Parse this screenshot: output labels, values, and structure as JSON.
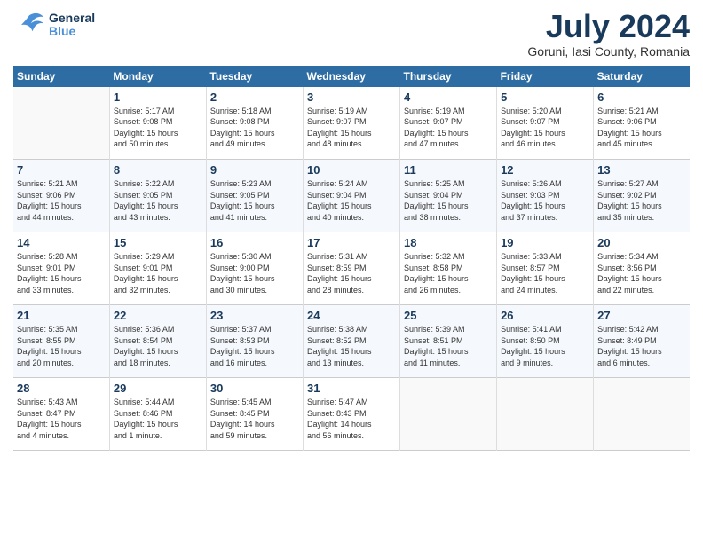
{
  "header": {
    "logo_general": "General",
    "logo_blue": "Blue",
    "month_title": "July 2024",
    "location": "Goruni, Iasi County, Romania"
  },
  "calendar": {
    "days_of_week": [
      "Sunday",
      "Monday",
      "Tuesday",
      "Wednesday",
      "Thursday",
      "Friday",
      "Saturday"
    ],
    "weeks": [
      {
        "cells": [
          {
            "day": "",
            "info": ""
          },
          {
            "day": "1",
            "info": "Sunrise: 5:17 AM\nSunset: 9:08 PM\nDaylight: 15 hours\nand 50 minutes."
          },
          {
            "day": "2",
            "info": "Sunrise: 5:18 AM\nSunset: 9:08 PM\nDaylight: 15 hours\nand 49 minutes."
          },
          {
            "day": "3",
            "info": "Sunrise: 5:19 AM\nSunset: 9:07 PM\nDaylight: 15 hours\nand 48 minutes."
          },
          {
            "day": "4",
            "info": "Sunrise: 5:19 AM\nSunset: 9:07 PM\nDaylight: 15 hours\nand 47 minutes."
          },
          {
            "day": "5",
            "info": "Sunrise: 5:20 AM\nSunset: 9:07 PM\nDaylight: 15 hours\nand 46 minutes."
          },
          {
            "day": "6",
            "info": "Sunrise: 5:21 AM\nSunset: 9:06 PM\nDaylight: 15 hours\nand 45 minutes."
          }
        ]
      },
      {
        "cells": [
          {
            "day": "7",
            "info": "Sunrise: 5:21 AM\nSunset: 9:06 PM\nDaylight: 15 hours\nand 44 minutes."
          },
          {
            "day": "8",
            "info": "Sunrise: 5:22 AM\nSunset: 9:05 PM\nDaylight: 15 hours\nand 43 minutes."
          },
          {
            "day": "9",
            "info": "Sunrise: 5:23 AM\nSunset: 9:05 PM\nDaylight: 15 hours\nand 41 minutes."
          },
          {
            "day": "10",
            "info": "Sunrise: 5:24 AM\nSunset: 9:04 PM\nDaylight: 15 hours\nand 40 minutes."
          },
          {
            "day": "11",
            "info": "Sunrise: 5:25 AM\nSunset: 9:04 PM\nDaylight: 15 hours\nand 38 minutes."
          },
          {
            "day": "12",
            "info": "Sunrise: 5:26 AM\nSunset: 9:03 PM\nDaylight: 15 hours\nand 37 minutes."
          },
          {
            "day": "13",
            "info": "Sunrise: 5:27 AM\nSunset: 9:02 PM\nDaylight: 15 hours\nand 35 minutes."
          }
        ]
      },
      {
        "cells": [
          {
            "day": "14",
            "info": "Sunrise: 5:28 AM\nSunset: 9:01 PM\nDaylight: 15 hours\nand 33 minutes."
          },
          {
            "day": "15",
            "info": "Sunrise: 5:29 AM\nSunset: 9:01 PM\nDaylight: 15 hours\nand 32 minutes."
          },
          {
            "day": "16",
            "info": "Sunrise: 5:30 AM\nSunset: 9:00 PM\nDaylight: 15 hours\nand 30 minutes."
          },
          {
            "day": "17",
            "info": "Sunrise: 5:31 AM\nSunset: 8:59 PM\nDaylight: 15 hours\nand 28 minutes."
          },
          {
            "day": "18",
            "info": "Sunrise: 5:32 AM\nSunset: 8:58 PM\nDaylight: 15 hours\nand 26 minutes."
          },
          {
            "day": "19",
            "info": "Sunrise: 5:33 AM\nSunset: 8:57 PM\nDaylight: 15 hours\nand 24 minutes."
          },
          {
            "day": "20",
            "info": "Sunrise: 5:34 AM\nSunset: 8:56 PM\nDaylight: 15 hours\nand 22 minutes."
          }
        ]
      },
      {
        "cells": [
          {
            "day": "21",
            "info": "Sunrise: 5:35 AM\nSunset: 8:55 PM\nDaylight: 15 hours\nand 20 minutes."
          },
          {
            "day": "22",
            "info": "Sunrise: 5:36 AM\nSunset: 8:54 PM\nDaylight: 15 hours\nand 18 minutes."
          },
          {
            "day": "23",
            "info": "Sunrise: 5:37 AM\nSunset: 8:53 PM\nDaylight: 15 hours\nand 16 minutes."
          },
          {
            "day": "24",
            "info": "Sunrise: 5:38 AM\nSunset: 8:52 PM\nDaylight: 15 hours\nand 13 minutes."
          },
          {
            "day": "25",
            "info": "Sunrise: 5:39 AM\nSunset: 8:51 PM\nDaylight: 15 hours\nand 11 minutes."
          },
          {
            "day": "26",
            "info": "Sunrise: 5:41 AM\nSunset: 8:50 PM\nDaylight: 15 hours\nand 9 minutes."
          },
          {
            "day": "27",
            "info": "Sunrise: 5:42 AM\nSunset: 8:49 PM\nDaylight: 15 hours\nand 6 minutes."
          }
        ]
      },
      {
        "cells": [
          {
            "day": "28",
            "info": "Sunrise: 5:43 AM\nSunset: 8:47 PM\nDaylight: 15 hours\nand 4 minutes."
          },
          {
            "day": "29",
            "info": "Sunrise: 5:44 AM\nSunset: 8:46 PM\nDaylight: 15 hours\nand 1 minute."
          },
          {
            "day": "30",
            "info": "Sunrise: 5:45 AM\nSunset: 8:45 PM\nDaylight: 14 hours\nand 59 minutes."
          },
          {
            "day": "31",
            "info": "Sunrise: 5:47 AM\nSunset: 8:43 PM\nDaylight: 14 hours\nand 56 minutes."
          },
          {
            "day": "",
            "info": ""
          },
          {
            "day": "",
            "info": ""
          },
          {
            "day": "",
            "info": ""
          }
        ]
      }
    ]
  }
}
